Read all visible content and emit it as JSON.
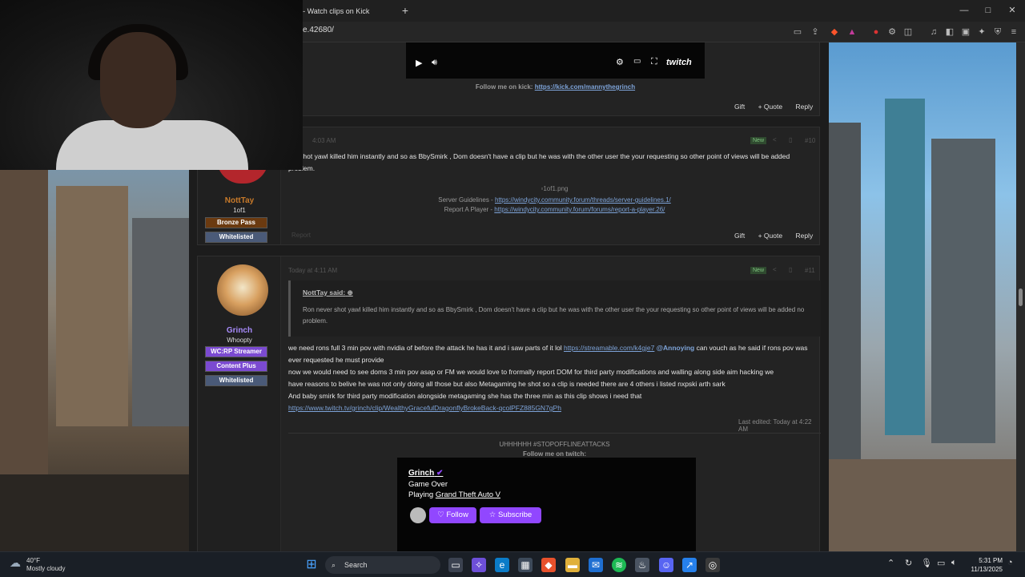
{
  "browser": {
    "tab_title": "│ - Watch clips on Kick",
    "url": "e.42680/",
    "new_tab": "+",
    "minimize": "—",
    "maximize": "□",
    "close": "✕"
  },
  "post1": {
    "follow_text": "Follow me on kick:",
    "follow_link": "https://kick.com/mannythegrinch",
    "actions": [
      "Gift",
      "+ Quote",
      "Reply"
    ]
  },
  "post2": {
    "date": "4:03 AM",
    "badge": "New",
    "number": "#10",
    "username": "NottTay",
    "user_title": "1of1",
    "banners": [
      "Bronze Pass",
      "Whitelisted"
    ],
    "message_line1": "ver shot yawl killed him instantly and so as BbySmirk , Dom doesn't have a clip but he was with the other user the your requesting so other point of views will be added",
    "message_line2": "problem.",
    "image_alt": "1of1.png",
    "guidelines_label": "Server Guidelines - ",
    "guidelines_link": "https://windycity.community.forum/threads/server-guidelines.1/",
    "report_label": "Report A Player - ",
    "report_link": "https://windycity.community.forum/forums/report-a-player.26/",
    "report_btn": "Report",
    "actions": [
      "Gift",
      "+ Quote",
      "Reply"
    ]
  },
  "post3": {
    "date": "Today at 4:11 AM",
    "badge": "New",
    "number": "#11",
    "username": "Grinch",
    "user_title": "Whoopty",
    "banners": [
      "WC:RP Streamer",
      "Content Plus",
      "Whitelisted"
    ],
    "quote_author": "NottTay said:",
    "quote_body": "Ron never shot yawl killed him instantly and so as BbySmirk , Dom doesn't have a clip but he was with the other user the your requesting so other point of views will be added no problem.",
    "line1_text": "we need rons full 3 min pov with nvidia of before the attack he has it and i saw parts of it lol ",
    "line1_link": "https://streamable.com/k4gje7",
    "line1_mention": "@Annoying",
    "line1_rest": " can vouch as he said if rons pov was",
    "line2": "ever requested he must provide",
    "line3": "now we would need to see doms 3 min pov asap or FM we would love to frormally report DOM for third party modifications and walling along side aim hacking we",
    "line4": "have reasons to belive he was not only doing all those but also Metagaming he shot so a clip is needed there are 4 others i listed nxpski arth sark",
    "line5": "And baby smirk for third party modification alongside metagaming she has the three min as this clip shows i need that",
    "clip_link": "https://www.twitch.tv/grinch/clip/WealthyGracefulDragonflyBrokeBack-qcolPFZ885GN7gPh",
    "last_edited": "Last edited: Today at 4:22 AM",
    "signature1": "UHHHHHH #STOPOFFLINEATTACKS",
    "signature2": "Follow me on twitch:",
    "embed_channel": "Grinch",
    "embed_status": "Game Over",
    "embed_playing_label": "Playing ",
    "embed_game": "Grand Theft Auto V",
    "follow_btn": "Follow",
    "subscribe_btn": "Subscribe"
  },
  "video": {
    "brand": "twitch"
  },
  "taskbar": {
    "temp": "40°F",
    "condition": "Mostly cloudy",
    "search": "Search",
    "time": "5:31 PM",
    "date": "11/13/2025"
  },
  "colors": {
    "bronze": "#6b3a10",
    "purple_banner": "#7b4ad1",
    "whitelisted": "#4a5a78",
    "twitch_purple": "#9147ff",
    "username_orange": "#c87a2a",
    "username_purple": "#a78bfa"
  }
}
